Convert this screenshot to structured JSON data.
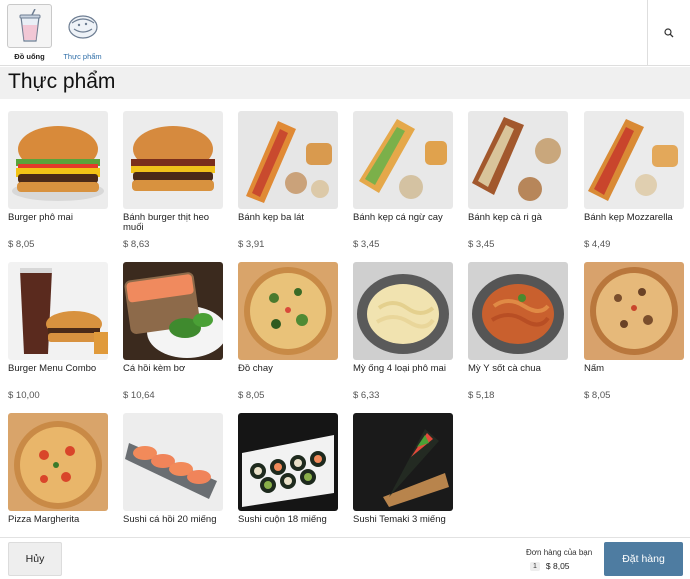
{
  "categories": [
    {
      "label": "Đồ uống",
      "icon": "drink-cup-icon",
      "active": true
    },
    {
      "label": "Thực phẩm",
      "icon": "food-box-icon",
      "active": false
    }
  ],
  "search": {
    "icon": "search-icon"
  },
  "section": {
    "title": "Thực phẩm"
  },
  "products": [
    {
      "name": "Burger phô mai",
      "price": "$ 8,05",
      "image": "cheeseburger"
    },
    {
      "name": "Bánh burger thịt heo muối",
      "price": "$ 8,63",
      "image": "bacon-burger"
    },
    {
      "name": "Bánh kẹp ba lát",
      "price": "$ 3,91",
      "image": "sandwich"
    },
    {
      "name": "Bánh kẹp cá ngừ cay",
      "price": "$ 3,45",
      "image": "tuna-sandwich"
    },
    {
      "name": "Bánh kẹp cà ri gà",
      "price": "$ 3,45",
      "image": "curry-sandwich"
    },
    {
      "name": "Bánh kẹp Mozzarella",
      "price": "$ 4,49",
      "image": "mozzarella-sandwich"
    },
    {
      "name": "Burger Menu Combo",
      "price": "$ 10,00",
      "image": "burger-combo"
    },
    {
      "name": "Cá hồi kèm bơ",
      "price": "$ 10,64",
      "image": "salmon-avocado"
    },
    {
      "name": "Đồ chay",
      "price": "$ 8,05",
      "image": "veggie-pizza"
    },
    {
      "name": "Mỳ ống 4 loại phô mai",
      "price": "$ 6,33",
      "image": "pasta-cheese"
    },
    {
      "name": "Mỳ Ý sốt cà chua",
      "price": "$ 5,18",
      "image": "pasta-tomato"
    },
    {
      "name": "Nấm",
      "price": "$ 8,05",
      "image": "mushroom-pizza"
    },
    {
      "name": "Pizza Margherita",
      "price": "",
      "image": "margherita-pizza"
    },
    {
      "name": "Sushi cá hồi 20 miếng",
      "price": "",
      "image": "salmon-sushi"
    },
    {
      "name": "Sushi cuộn 18 miếng",
      "price": "",
      "image": "sushi-rolls"
    },
    {
      "name": "Sushi Temaki 3 miếng",
      "price": "",
      "image": "temaki"
    }
  ],
  "footer": {
    "cancel_label": "Hủy",
    "order_title": "Đơn hàng của bạn",
    "order_qty": "1",
    "order_total": "$ 8,05",
    "place_order_label": "Đặt hàng"
  },
  "colors": {
    "accent": "#4e7ca1",
    "link": "#2f6ea8",
    "section_bg": "#f0f0f0"
  }
}
